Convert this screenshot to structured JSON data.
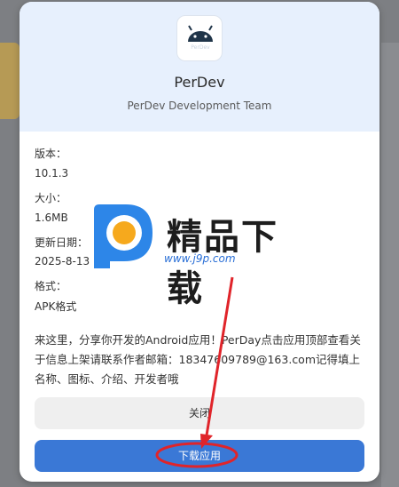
{
  "app": {
    "name": "PerDev",
    "team": "PerDev Development Team",
    "icon_caption": "PerDev"
  },
  "info": {
    "version_label": "版本：",
    "version": "10.1.3",
    "size_label": "大小：",
    "size": "1.6MB",
    "date_label": "更新日期：",
    "date": "2025-8-13",
    "format_label": "格式：",
    "format": "APK格式"
  },
  "description": "来这里，分享你开发的Android应用！PerDay点击应用顶部查看关于信息上架请联系作者邮箱：18347609789@163.com记得填上名称、图标、介绍、开发者哦",
  "buttons": {
    "close": "关闭",
    "download": "下载应用"
  },
  "watermark": {
    "text": "精品下载",
    "url": "www.j9p.com"
  },
  "colors": {
    "accent": "#3a78d6",
    "header_bg": "#e7f0fd",
    "annotation": "#e0242a"
  }
}
